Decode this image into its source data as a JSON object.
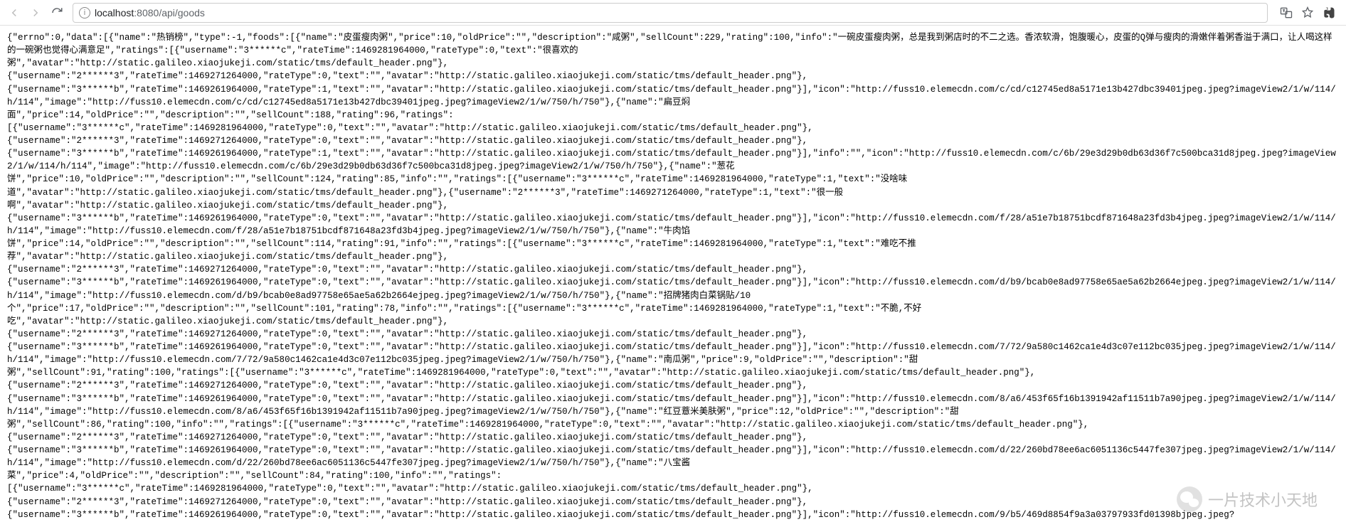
{
  "toolbar": {
    "url_host": "localhost",
    "url_port": ":8080",
    "url_path": "/api/goods"
  },
  "response_text": "{\"errno\":0,\"data\":[{\"name\":\"热销榜\",\"type\":-1,\"foods\":[{\"name\":\"皮蛋瘦肉粥\",\"price\":10,\"oldPrice\":\"\",\"description\":\"咸粥\",\"sellCount\":229,\"rating\":100,\"info\":\"一碗皮蛋瘦肉粥，总是我到粥店时的不二之选。香浓软滑，饱腹暖心，皮蛋的Q弹与瘦肉的滑嫩伴着粥香溢于满口，让人喝这样的一碗粥也觉得心满意足\",\"ratings\":[{\"username\":\"3******c\",\"rateTime\":1469281964000,\"rateType\":0,\"text\":\"很喜欢的\n粥\",\"avatar\":\"http://static.galileo.xiaojukeji.com/static/tms/default_header.png\"},\n{\"username\":\"2******3\",\"rateTime\":1469271264000,\"rateType\":0,\"text\":\"\",\"avatar\":\"http://static.galileo.xiaojukeji.com/static/tms/default_header.png\"},\n{\"username\":\"3******b\",\"rateTime\":1469261964000,\"rateType\":1,\"text\":\"\",\"avatar\":\"http://static.galileo.xiaojukeji.com/static/tms/default_header.png\"}],\"icon\":\"http://fuss10.elemecdn.com/c/cd/c12745ed8a5171e13b427dbc39401jpeg.jpeg?imageView2/1/w/114/h/114\",\"image\":\"http://fuss10.elemecdn.com/c/cd/c12745ed8a5171e13b427dbc39401jpeg.jpeg?imageView2/1/w/750/h/750\"},{\"name\":\"扁豆焖\n面\",\"price\":14,\"oldPrice\":\"\",\"description\":\"\",\"sellCount\":188,\"rating\":96,\"ratings\":\n[{\"username\":\"3******c\",\"rateTime\":1469281964000,\"rateType\":0,\"text\":\"\",\"avatar\":\"http://static.galileo.xiaojukeji.com/static/tms/default_header.png\"},\n{\"username\":\"2******3\",\"rateTime\":1469271264000,\"rateType\":0,\"text\":\"\",\"avatar\":\"http://static.galileo.xiaojukeji.com/static/tms/default_header.png\"},\n{\"username\":\"3******b\",\"rateTime\":1469261964000,\"rateType\":1,\"text\":\"\",\"avatar\":\"http://static.galileo.xiaojukeji.com/static/tms/default_header.png\"}],\"info\":\"\",\"icon\":\"http://fuss10.elemecdn.com/c/6b/29e3d29b0db63d36f7c500bca31d8jpeg.jpeg?imageView2/1/w/114/h/114\",\"image\":\"http://fuss10.elemecdn.com/c/6b/29e3d29b0db63d36f7c500bca31d8jpeg.jpeg?imageView2/1/w/750/h/750\"},{\"name\":\"葱花\n饼\",\"price\":10,\"oldPrice\":\"\",\"description\":\"\",\"sellCount\":124,\"rating\":85,\"info\":\"\",\"ratings\":[{\"username\":\"3******c\",\"rateTime\":1469281964000,\"rateType\":1,\"text\":\"没啥味\n道\",\"avatar\":\"http://static.galileo.xiaojukeji.com/static/tms/default_header.png\"},{\"username\":\"2******3\",\"rateTime\":1469271264000,\"rateType\":1,\"text\":\"很一般\n啊\",\"avatar\":\"http://static.galileo.xiaojukeji.com/static/tms/default_header.png\"},\n{\"username\":\"3******b\",\"rateTime\":1469261964000,\"rateType\":0,\"text\":\"\",\"avatar\":\"http://static.galileo.xiaojukeji.com/static/tms/default_header.png\"}],\"icon\":\"http://fuss10.elemecdn.com/f/28/a51e7b18751bcdf871648a23fd3b4jpeg.jpeg?imageView2/1/w/114/h/114\",\"image\":\"http://fuss10.elemecdn.com/f/28/a51e7b18751bcdf871648a23fd3b4jpeg.jpeg?imageView2/1/w/750/h/750\"},{\"name\":\"牛肉馅\n饼\",\"price\":14,\"oldPrice\":\"\",\"description\":\"\",\"sellCount\":114,\"rating\":91,\"info\":\"\",\"ratings\":[{\"username\":\"3******c\",\"rateTime\":1469281964000,\"rateType\":1,\"text\":\"难吃不推\n荐\",\"avatar\":\"http://static.galileo.xiaojukeji.com/static/tms/default_header.png\"},\n{\"username\":\"2******3\",\"rateTime\":1469271264000,\"rateType\":0,\"text\":\"\",\"avatar\":\"http://static.galileo.xiaojukeji.com/static/tms/default_header.png\"},\n{\"username\":\"3******b\",\"rateTime\":1469261964000,\"rateType\":0,\"text\":\"\",\"avatar\":\"http://static.galileo.xiaojukeji.com/static/tms/default_header.png\"}],\"icon\":\"http://fuss10.elemecdn.com/d/b9/bcab0e8ad97758e65ae5a62b2664ejpeg.jpeg?imageView2/1/w/114/h/114\",\"image\":\"http://fuss10.elemecdn.com/d/b9/bcab0e8ad97758e65ae5a62b2664ejpeg.jpeg?imageView2/1/w/750/h/750\"},{\"name\":\"招牌猪肉白菜锅贴/10\n个\",\"price\":17,\"oldPrice\":\"\",\"description\":\"\",\"sellCount\":101,\"rating\":78,\"info\":\"\",\"ratings\":[{\"username\":\"3******c\",\"rateTime\":1469281964000,\"rateType\":1,\"text\":\"不脆,不好\n吃\",\"avatar\":\"http://static.galileo.xiaojukeji.com/static/tms/default_header.png\"},\n{\"username\":\"2******3\",\"rateTime\":1469271264000,\"rateType\":0,\"text\":\"\",\"avatar\":\"http://static.galileo.xiaojukeji.com/static/tms/default_header.png\"},\n{\"username\":\"3******b\",\"rateTime\":1469261964000,\"rateType\":0,\"text\":\"\",\"avatar\":\"http://static.galileo.xiaojukeji.com/static/tms/default_header.png\"}],\"icon\":\"http://fuss10.elemecdn.com/7/72/9a580c1462ca1e4d3c07e112bc035jpeg.jpeg?imageView2/1/w/114/h/114\",\"image\":\"http://fuss10.elemecdn.com/7/72/9a580c1462ca1e4d3c07e112bc035jpeg.jpeg?imageView2/1/w/750/h/750\"},{\"name\":\"南瓜粥\",\"price\":9,\"oldPrice\":\"\",\"description\":\"甜\n粥\",\"sellCount\":91,\"rating\":100,\"ratings\":[{\"username\":\"3******c\",\"rateTime\":1469281964000,\"rateType\":0,\"text\":\"\",\"avatar\":\"http://static.galileo.xiaojukeji.com/static/tms/default_header.png\"},\n{\"username\":\"2******3\",\"rateTime\":1469271264000,\"rateType\":0,\"text\":\"\",\"avatar\":\"http://static.galileo.xiaojukeji.com/static/tms/default_header.png\"},\n{\"username\":\"3******b\",\"rateTime\":1469261964000,\"rateType\":0,\"text\":\"\",\"avatar\":\"http://static.galileo.xiaojukeji.com/static/tms/default_header.png\"}],\"icon\":\"http://fuss10.elemecdn.com/8/a6/453f65f16b1391942af11511b7a90jpeg.jpeg?imageView2/1/w/114/h/114\",\"image\":\"http://fuss10.elemecdn.com/8/a6/453f65f16b1391942af11511b7a90jpeg.jpeg?imageView2/1/w/750/h/750\"},{\"name\":\"红豆薏米美肤粥\",\"price\":12,\"oldPrice\":\"\",\"description\":\"甜\n粥\",\"sellCount\":86,\"rating\":100,\"info\":\"\",\"ratings\":[{\"username\":\"3******c\",\"rateTime\":1469281964000,\"rateType\":0,\"text\":\"\",\"avatar\":\"http://static.galileo.xiaojukeji.com/static/tms/default_header.png\"},\n{\"username\":\"2******3\",\"rateTime\":1469271264000,\"rateType\":0,\"text\":\"\",\"avatar\":\"http://static.galileo.xiaojukeji.com/static/tms/default_header.png\"},\n{\"username\":\"3******b\",\"rateTime\":1469261964000,\"rateType\":0,\"text\":\"\",\"avatar\":\"http://static.galileo.xiaojukeji.com/static/tms/default_header.png\"}],\"icon\":\"http://fuss10.elemecdn.com/d/22/260bd78ee6ac6051136c5447fe307jpeg.jpeg?imageView2/1/w/114/h/114\",\"image\":\"http://fuss10.elemecdn.com/d/22/260bd78ee6ac6051136c5447fe307jpeg.jpeg?imageView2/1/w/750/h/750\"},{\"name\":\"八宝酱\n菜\",\"price\":4,\"oldPrice\":\"\",\"description\":\"\",\"sellCount\":84,\"rating\":100,\"info\":\"\",\"ratings\":\n[{\"username\":\"3******c\",\"rateTime\":1469281964000,\"rateType\":0,\"text\":\"\",\"avatar\":\"http://static.galileo.xiaojukeji.com/static/tms/default_header.png\"},\n{\"username\":\"2******3\",\"rateTime\":1469271264000,\"rateType\":0,\"text\":\"\",\"avatar\":\"http://static.galileo.xiaojukeji.com/static/tms/default_header.png\"},\n{\"username\":\"3******b\",\"rateTime\":1469261964000,\"rateType\":0,\"text\":\"\",\"avatar\":\"http://static.galileo.xiaojukeji.com/static/tms/default_header.png\"}],\"icon\":\"http://fuss10.elemecdn.com/9/b5/469d8854f9a3a03797933fd01398bjpeg.jpeg?",
  "watermark": {
    "text": "一片技术小天地"
  }
}
